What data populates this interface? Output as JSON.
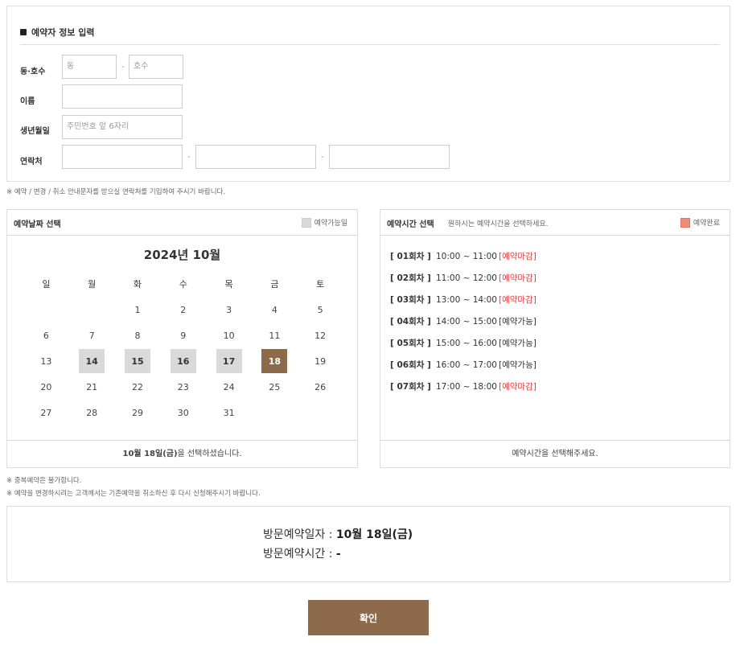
{
  "info": {
    "title": "예약자 정보 입력",
    "dong_label": "동·호수",
    "dong_placeholder": "동",
    "ho_placeholder": "호수",
    "name_label": "이름",
    "birth_label": "생년월일",
    "birth_placeholder": "주민번호 앞 6자리",
    "phone_label": "연락처",
    "dash": "-"
  },
  "note_contact": "※ 예약 / 변경 / 취소 안내문자를 받으실 연락처를 기입하여 주시기 바랍니다.",
  "calendar": {
    "panel_title": "예약날짜 선택",
    "legend_label": "예약가능일",
    "month_title": "2024년 10월",
    "weekdays": [
      "일",
      "월",
      "화",
      "수",
      "목",
      "금",
      "토"
    ],
    "weeks": [
      [
        "",
        "",
        "1",
        "2",
        "3",
        "4",
        "5"
      ],
      [
        "6",
        "7",
        "8",
        "9",
        "10",
        "11",
        "12"
      ],
      [
        "13",
        "14",
        "15",
        "16",
        "17",
        "18",
        "19"
      ],
      [
        "20",
        "21",
        "22",
        "23",
        "24",
        "25",
        "26"
      ],
      [
        "27",
        "28",
        "29",
        "30",
        "31",
        "",
        ""
      ]
    ],
    "available_days": [
      "14",
      "15",
      "16",
      "17"
    ],
    "selected_day": "18",
    "selected_text_bold": "10월 18일(금)",
    "selected_text_rest": "을 선택하셨습니다.",
    "available_color": "#d9d9d9",
    "selected_color": "#8b6b4b"
  },
  "times": {
    "panel_title": "예약시간 선택",
    "panel_sub": "원하시는 예약시간을 선택하세요.",
    "legend_label": "예약완료",
    "legend_color": "#f28b74",
    "slots": [
      {
        "round": "[ 01회차 ]",
        "time": "10:00 ~ 11:00",
        "status": "[예약마감]",
        "closed": true
      },
      {
        "round": "[ 02회차 ]",
        "time": "11:00 ~ 12:00",
        "status": "[예약마감]",
        "closed": true
      },
      {
        "round": "[ 03회차 ]",
        "time": "13:00 ~ 14:00",
        "status": "[예약마감]",
        "closed": true
      },
      {
        "round": "[ 04회차 ]",
        "time": "14:00 ~ 15:00",
        "status": "[예약가능]",
        "closed": false
      },
      {
        "round": "[ 05회차 ]",
        "time": "15:00 ~ 16:00",
        "status": "[예약가능]",
        "closed": false
      },
      {
        "round": "[ 06회차 ]",
        "time": "16:00 ~ 17:00",
        "status": "[예약가능]",
        "closed": false
      },
      {
        "round": "[ 07회차 ]",
        "time": "17:00 ~ 18:00",
        "status": "[예약마감]",
        "closed": true
      }
    ],
    "footer": "예약시간을 선택해주세요."
  },
  "note_dup": "※ 중복예약은 불가합니다.",
  "note_change": "※ 예약을 변경하시려는 고객께서는 기존예약을 취소하신 후 다시 신청해주시기 바랍니다.",
  "summary": {
    "date_label": "방문예약일자 : ",
    "date_value": "10월 18일(금)",
    "time_label": "방문예약시간 : ",
    "time_value": "-"
  },
  "confirm_label": "확인"
}
